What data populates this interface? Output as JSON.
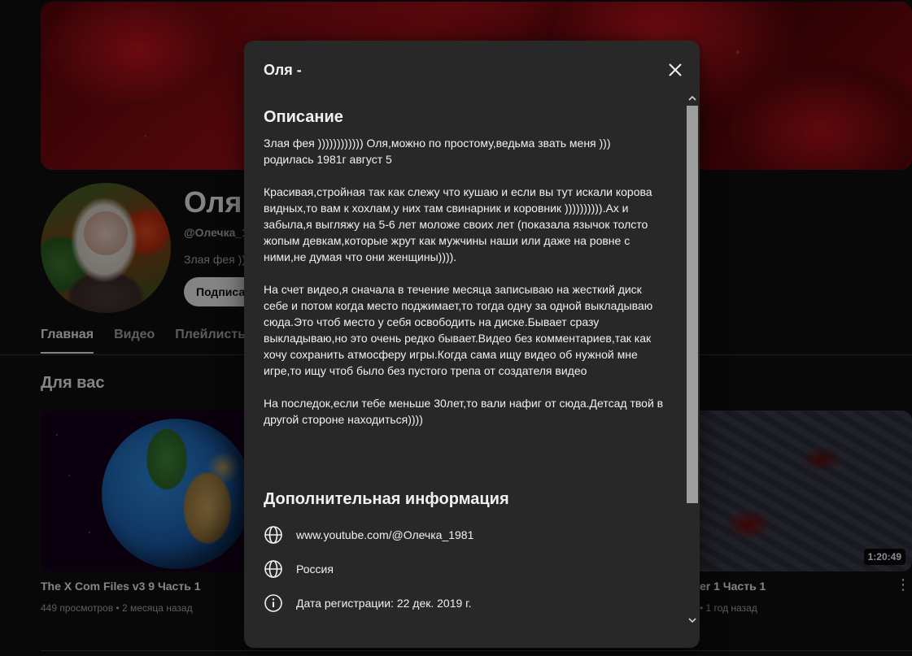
{
  "channel": {
    "name": "Оля",
    "handle": "@Олечка_1",
    "description_preview": "Злая фея ))",
    "subscribe_label": "Подписат"
  },
  "tabs": [
    {
      "label": "Главная",
      "active": true
    },
    {
      "label": "Видео",
      "active": false
    },
    {
      "label": "Плейлисты",
      "active": false
    }
  ],
  "section": {
    "title": "Для вас"
  },
  "videos": [
    {
      "title": "The X Com Files v3 9 Часть 1",
      "meta": "449 просмотров • 2 месяца назад"
    },
    {
      "title": "er 1 Часть 1",
      "meta": "• 1 год назад",
      "duration": "1:20:49"
    }
  ],
  "dialog": {
    "title": "Оля -",
    "description_heading": "Описание",
    "description": "Злая фея )))))))))))) Оля,можно по простому,ведьма звать меня )))\nродилась 1981г август 5\n\nКрасивая,стройная так как слежу что кушаю и если вы тут искали корова видных,то вам к хохлам,у них там свинарник и коровник )))))))))).Ах и забыла,я выгляжу на 5-6 лет моложе своих лет (показала язычок толсто жопым девкам,которые жрут как мужчины наши или даже на ровне с ними,не думая что они женщины)))).\n\nНа счет видео,я сначала в течение месяца записываю на жесткий диск себе и потом когда место поджимает,то тогда одну за одной выкладываю сюда.Это чтоб место у себя освободить на диске.Бывает сразу выкладываю,но это очень редко бывает.Видео без комментариев,так как хочу сохранить атмосферу игры.Когда сама ищу видео об нужной мне игре,то ищу чтоб было без пустого трепа от создателя видео\n\nНа последок,если тебе меньше 30лет,то вали нафиг от сюда.Детсад твой в другой стороне находиться))))",
    "more_info_heading": "Дополнительная информация",
    "info": {
      "url": "www.youtube.com/@Олечка_1981",
      "country": "Россия",
      "joined": "Дата регистрации: 22 дек. 2019 г."
    }
  },
  "icons": {
    "close": "close-icon",
    "globe": "globe-icon",
    "info": "info-icon"
  }
}
